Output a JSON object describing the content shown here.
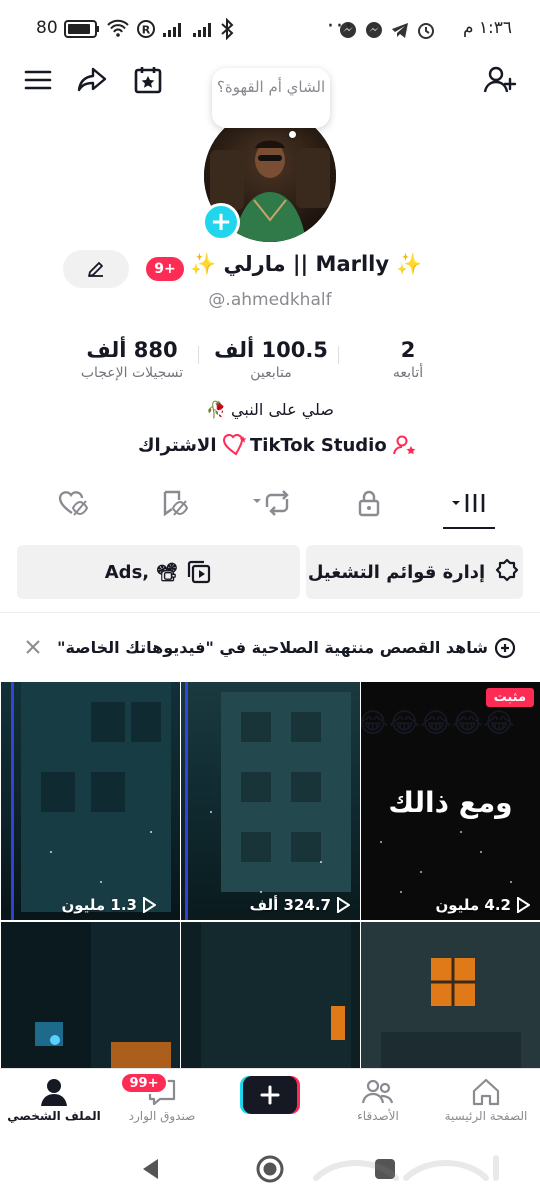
{
  "status_bar": {
    "time": "١:٣٦ م",
    "battery": "80"
  },
  "header": {
    "note_bubble": "الشاي أم القهوة؟",
    "display_name": "✨ مارلي || Marlly ✨",
    "notification_badge": "9+",
    "username": "@.ahmedkhalf"
  },
  "stats": [
    {
      "value": "2",
      "label": "أتابعه"
    },
    {
      "value": "100.5 ألف",
      "label": "متابعين"
    },
    {
      "value": "880 ألف",
      "label": "تسجيلات الإعجاب"
    }
  ],
  "bio": "صلي على النبي 🥀",
  "links": {
    "studio": "TikTok Studio",
    "subscription": "الاشتراك"
  },
  "actions": {
    "playlists": "إدارة قوائم التشغيل",
    "ads": "Ads, 📽"
  },
  "banner": {
    "text": "شاهد القصص منتهية الصلاحية في \"فيديوهاتك الخاصة\""
  },
  "videos": [
    {
      "views": "4.2 مليون",
      "pinned_label": "مثبت",
      "caption": "ومع ذالك",
      "emojis": "😂😂😂😂😂"
    },
    {
      "views": "324.7 ألف"
    },
    {
      "views": "1.3 مليون"
    },
    {},
    {},
    {}
  ],
  "bottom_nav": {
    "home": "الصفحة الرئيسية",
    "friends": "الأصدقاء",
    "inbox": "صندوق الوارد",
    "inbox_badge": "99+",
    "profile": "الملف الشخصي"
  },
  "colors": {
    "accent_red": "#fe2c55",
    "accent_cyan": "#20d5ec",
    "text_primary": "#161823",
    "text_secondary": "#8a8b91"
  }
}
